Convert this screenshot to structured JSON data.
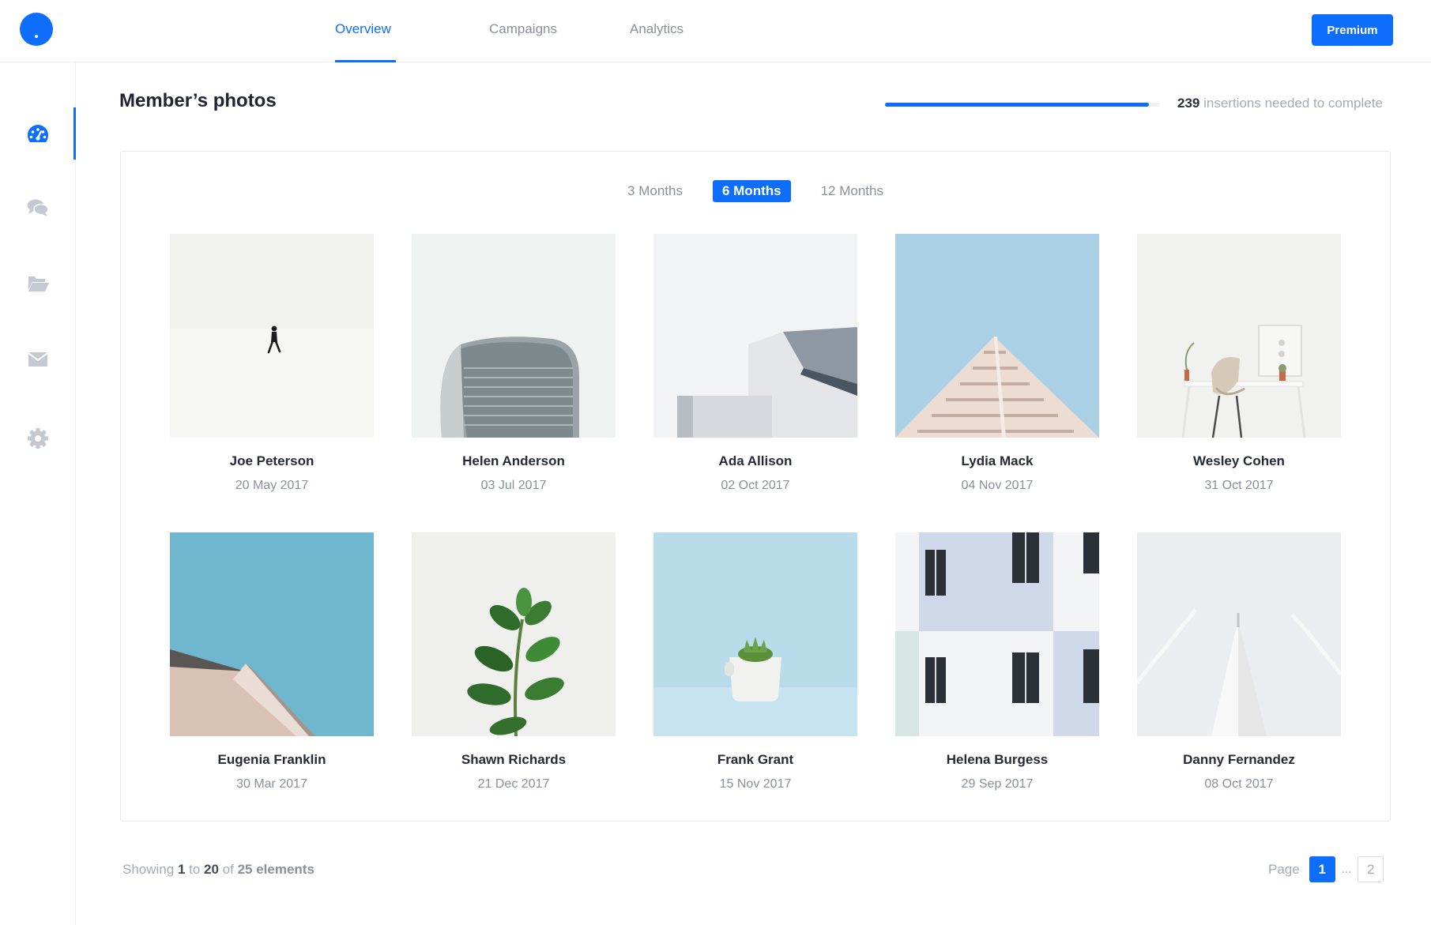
{
  "topbar": {
    "tabs": [
      {
        "label": "Overview"
      },
      {
        "label": "Campaigns"
      },
      {
        "label": "Analytics"
      }
    ],
    "premium_label": "Premium"
  },
  "sidebar": {
    "items": [
      {
        "icon": "dashboard-gauge-icon"
      },
      {
        "icon": "chat-bubbles-icon"
      },
      {
        "icon": "folder-open-icon"
      },
      {
        "icon": "envelope-icon"
      },
      {
        "icon": "gear-icon"
      }
    ]
  },
  "main": {
    "title": "Member’s photos",
    "progress": {
      "fraction": 0.96,
      "count": "239",
      "text": " insertions needed to complete"
    },
    "ranges": [
      {
        "label": "3 Months"
      },
      {
        "label": "6 Months"
      },
      {
        "label": "12 Months"
      }
    ],
    "active_range": "6 Months",
    "photos": [
      {
        "name": "Joe Peterson",
        "date": "20 May 2017"
      },
      {
        "name": "Helen Anderson",
        "date": "03 Jul 2017"
      },
      {
        "name": "Ada Allison",
        "date": "02 Oct 2017"
      },
      {
        "name": "Lydia Mack",
        "date": "04 Nov 2017"
      },
      {
        "name": "Wesley Cohen",
        "date": "31 Oct 2017"
      },
      {
        "name": "Eugenia Franklin",
        "date": "30 Mar 2017"
      },
      {
        "name": "Shawn Richards",
        "date": "21 Dec 2017"
      },
      {
        "name": "Frank Grant",
        "date": "15 Nov 2017"
      },
      {
        "name": "Helena Burgess",
        "date": "29 Sep 2017"
      },
      {
        "name": "Danny Fernandez",
        "date": "08 Oct 2017"
      }
    ]
  },
  "footer": {
    "showing_prefix": "Showing ",
    "from": "1",
    "to_word": " to ",
    "to": "20",
    "of_word": " of ",
    "total": "25 elements",
    "page_label": "Page",
    "current_page": "1",
    "ellipsis": "...",
    "last_page": "2"
  },
  "colors": {
    "accent": "#0d6efd",
    "muted_text": "#8a8f9c",
    "border": "#eceef2"
  }
}
